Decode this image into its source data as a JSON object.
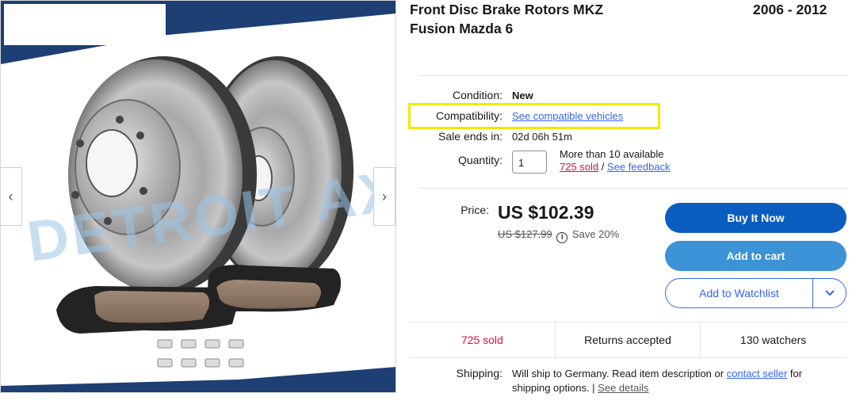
{
  "listing": {
    "title": "Front Disc Brake Rotors MKZ Fusion Mazda 6",
    "years": "2006 - 2012"
  },
  "gallery": {
    "watermark": "DETROIT AXLE",
    "prev_icon": "chevron-left-icon",
    "next_icon": "chevron-right-icon"
  },
  "details": {
    "condition_label": "Condition:",
    "condition_value": "New",
    "compatibility_label": "Compatibility:",
    "compatibility_link": "See compatible vehicles",
    "sale_label": "Sale ends in:",
    "sale_value": "02d 06h 51m",
    "quantity_label": "Quantity:",
    "quantity_value": "1",
    "availability": "More than 10 available",
    "sold_link": "725 sold",
    "separator": "/",
    "feedback_link": "See feedback"
  },
  "pricing": {
    "price_label": "Price:",
    "price": "US $102.39",
    "was_price": "US $127.99",
    "save": "Save 20%"
  },
  "actions": {
    "buy_now": "Buy It Now",
    "add_to_cart": "Add to cart",
    "add_to_watchlist": "Add to Watchlist",
    "watchlist_dropdown_icon": "chevron-down-icon"
  },
  "stats": {
    "sold": "725 sold",
    "returns": "Returns accepted",
    "watchers": "130 watchers"
  },
  "shipping": {
    "label": "Shipping:",
    "text_before": "Will ship to Germany. Read item description or ",
    "contact_link": "contact seller",
    "text_after": " for shipping options. | ",
    "details_link": "See details"
  },
  "colors": {
    "buy_now_bg": "#0b5cbf",
    "add_to_cart_bg": "#3c93d5",
    "link": "#3665f3",
    "sold_red": "#e0103a",
    "highlight": "#f5e700"
  }
}
